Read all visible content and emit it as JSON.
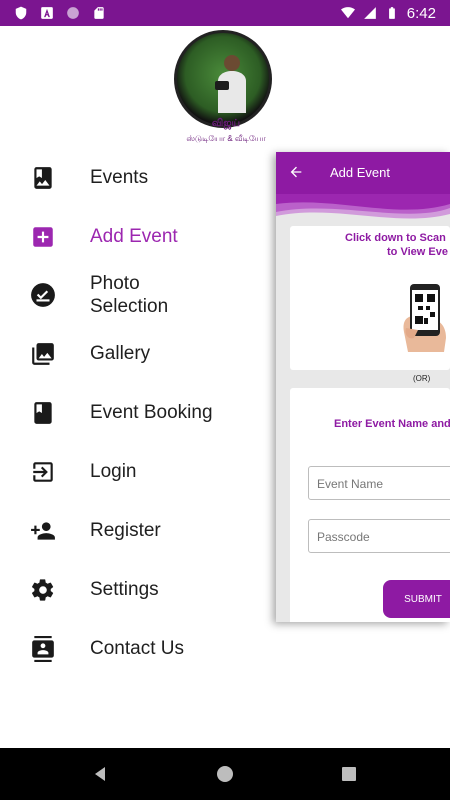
{
  "status_bar": {
    "time": "6:42",
    "left_icons": [
      "shield-icon",
      "font-a-icon",
      "circle-icon",
      "sd-card-icon"
    ],
    "right_icons": [
      "wifi-icon",
      "signal-icon",
      "battery-icon"
    ]
  },
  "logo": {
    "title": "விஜய்",
    "subtitle": "ஸ்டுடியோ & வீடியோ"
  },
  "menu": {
    "items": [
      {
        "label": "Events",
        "icon": "bookmark-image-icon",
        "active": false
      },
      {
        "label": "Add Event",
        "icon": "add-box-icon",
        "active": true
      },
      {
        "label": "Photo\nSelection",
        "icon": "check-circle-icon",
        "active": false
      },
      {
        "label": "Gallery",
        "icon": "photo-library-icon",
        "active": false
      },
      {
        "label": "Event Booking",
        "icon": "book-icon",
        "active": false
      },
      {
        "label": "Login",
        "icon": "login-icon",
        "active": false
      },
      {
        "label": "Register",
        "icon": "person-add-icon",
        "active": false
      },
      {
        "label": "Settings",
        "icon": "gear-icon",
        "active": false
      },
      {
        "label": "Contact Us",
        "icon": "contacts-icon",
        "active": false
      }
    ]
  },
  "app_preview": {
    "title": "Add Event",
    "scan_line1": "Click down to Scan",
    "scan_line2": "to View Eve",
    "or_text": "(OR)",
    "enter_text": "Enter Event Name and",
    "event_name_placeholder": "Event Name",
    "passcode_placeholder": "Passcode",
    "submit_label": "SUBMIT"
  },
  "colors": {
    "status_bar": "#7b1590",
    "accent": "#9c27b0",
    "toolbar": "#8e1aa3"
  }
}
